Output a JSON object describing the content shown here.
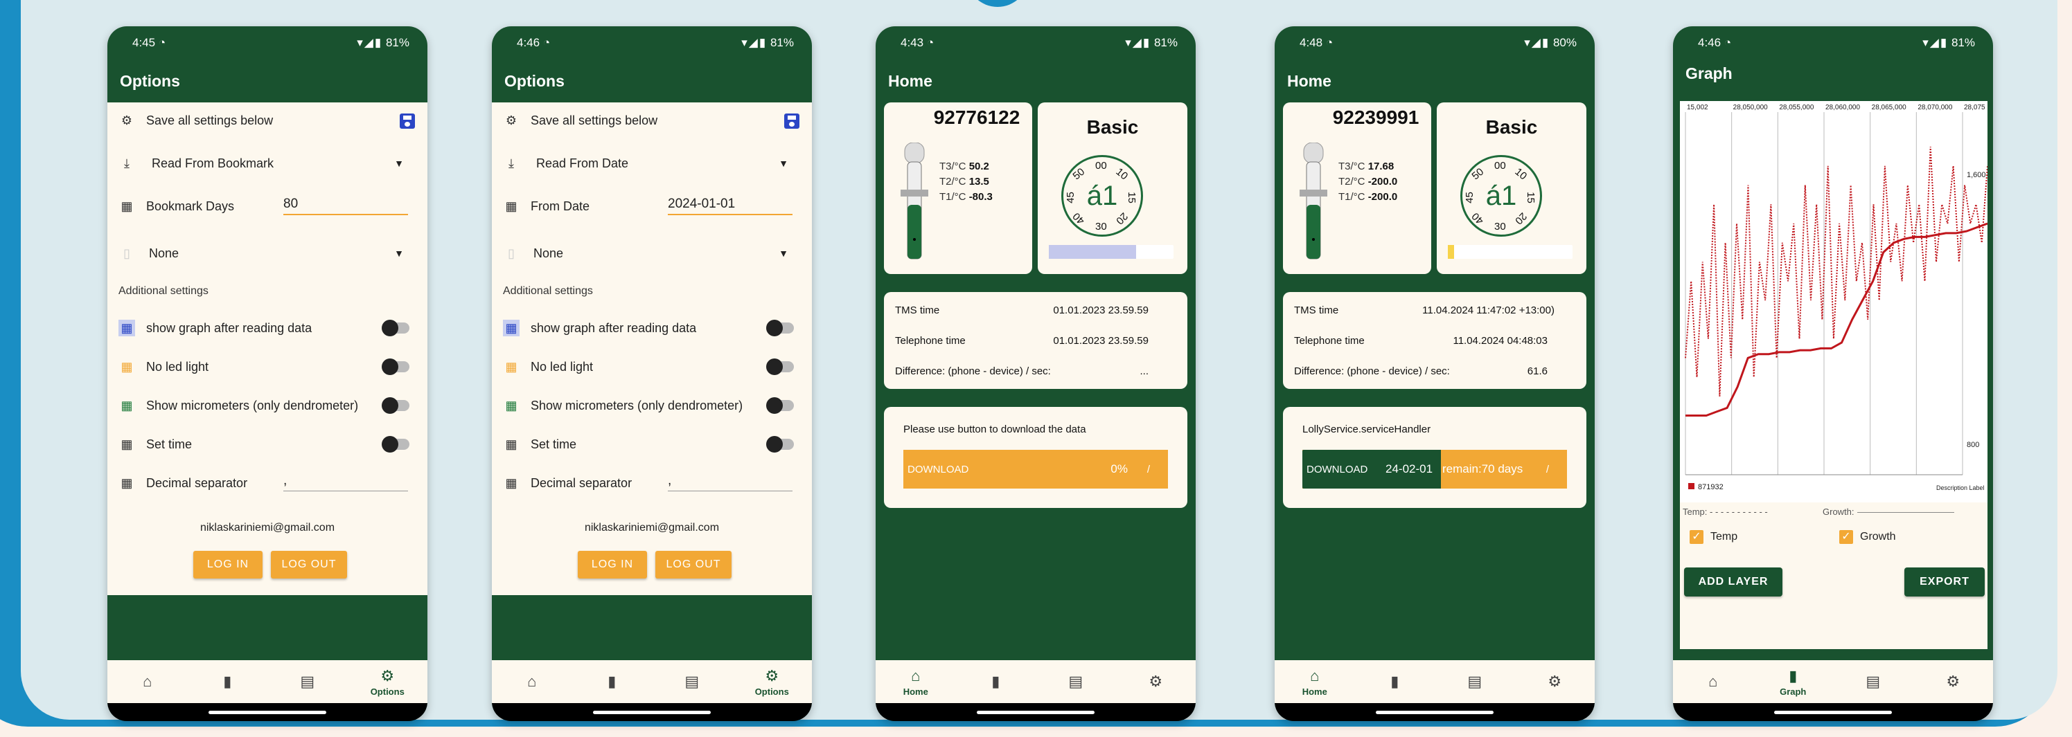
{
  "colors": {
    "primary": "#19522f",
    "accent": "#f2a835",
    "surface": "#fdf8ee",
    "series": "#c0161c"
  },
  "nav": {
    "home": "Home",
    "graph": "Graph",
    "options": "Options"
  },
  "status": {
    "icons": "▾◢▮"
  },
  "options1": {
    "time": "4:45",
    "battery": "81%",
    "title": "Options",
    "save_label": "Save all settings below",
    "read_mode": "Read From Bookmark",
    "field_label": "Bookmark Days",
    "field_value": "80",
    "none_label": "None",
    "additional": "Additional settings",
    "toggles": [
      "show graph after reading data",
      "No led light",
      "Show micrometers (only dendrometer)",
      "Set time"
    ],
    "decimal_label": "Decimal separator",
    "decimal_value": ",",
    "email": "niklaskariniemi@gmail.com",
    "login": "LOG IN",
    "logout": "LOG OUT"
  },
  "options2": {
    "time": "4:46",
    "battery": "81%",
    "title": "Options",
    "save_label": "Save all settings below",
    "read_mode": "Read From Date",
    "field_label": "From Date",
    "field_value": "2024-01-01",
    "none_label": "None",
    "additional": "Additional settings",
    "toggles": [
      "show graph after reading data",
      "No led light",
      "Show micrometers (only dendrometer)",
      "Set time"
    ],
    "decimal_label": "Decimal separator",
    "decimal_value": ",",
    "email": "niklaskariniemi@gmail.com",
    "login": "LOG IN",
    "logout": "LOG OUT"
  },
  "home1": {
    "time": "4:43",
    "battery": "81%",
    "title": "Home",
    "device_id": "92776122",
    "t3_label": "T3/°C",
    "t3": "50.2",
    "t2_label": "T2/°C",
    "t2": "13.5",
    "t1_label": "T1/°C",
    "t1": "-80.3",
    "model": "Basic",
    "dial_center": "á1",
    "dial_nums": [
      "00",
      "10",
      "15",
      "20",
      "30",
      "40",
      "45",
      "50"
    ],
    "progress_fraction": 0.7,
    "tms_label": "TMS time",
    "tms": "01.01.2023 23.59.59",
    "phone_label": "Telephone time",
    "phone": "01.01.2023 23.59.59",
    "diff_label": "Difference: (phone - device) / sec:",
    "diff": "...",
    "msg": "Please use button to download the data",
    "download": "DOWNLOAD",
    "pct": "0%",
    "slash": "/"
  },
  "home2": {
    "time": "4:48",
    "battery": "80%",
    "title": "Home",
    "device_id": "92239991",
    "t3_label": "T3/°C",
    "t3": "17.68",
    "t2_label": "T2/°C",
    "t2": "-200.0",
    "t1_label": "T1/°C",
    "t1": "-200.0",
    "model": "Basic",
    "dial_center": "á1",
    "dial_nums": [
      "00",
      "10",
      "15",
      "20",
      "30",
      "40",
      "45",
      "50"
    ],
    "progress_fraction": 0.05,
    "tms_label": "TMS time",
    "tms": "11.04.2024 11:47:02 +13:00)",
    "phone_label": "Telephone time",
    "phone": "11.04.2024 04:48:03",
    "diff_label": "Difference: (phone - device) / sec:",
    "diff": "61.6",
    "msg": "LollyService.serviceHandler",
    "download": "DOWNLOAD",
    "date": "24-02-01",
    "remain": "remain:70 days",
    "slash": "/"
  },
  "graph": {
    "time": "4:46",
    "battery": "81%",
    "title": "Graph",
    "legend_series": "871932",
    "desc_label": "Description Label",
    "temp_line": "Temp: - - - - - - - - - - -",
    "growth_line": "Growth:",
    "chk_temp": "Temp",
    "chk_growth": "Growth",
    "add_layer": "ADD LAYER",
    "export": "EXPORT"
  },
  "chart_data": {
    "type": "line",
    "x_ticks": [
      "15,002",
      "28,050,000",
      "28,055,000",
      "28,060,000",
      "28,065,000",
      "28,070,000",
      "28,075"
    ],
    "y_right_ticks": [
      "1,600",
      "800"
    ],
    "series": [
      {
        "name": "871932",
        "style": "dotted",
        "values": [
          5,
          9,
          4,
          10,
          6,
          13,
          3,
          11,
          5,
          12,
          7,
          14,
          4,
          10,
          8,
          13,
          5,
          11,
          9,
          12,
          6,
          14,
          8,
          13,
          7,
          15,
          6,
          12,
          8,
          14,
          9,
          11,
          7,
          13,
          8,
          15,
          10,
          12,
          9,
          14,
          11,
          13,
          9,
          16,
          10,
          13,
          12,
          15,
          10,
          14,
          12,
          13,
          11,
          15
        ]
      },
      {
        "style": "solid",
        "values": [
          2,
          2,
          2,
          2.2,
          2.4,
          3.5,
          5,
          5.2,
          5.2,
          5.3,
          5.3,
          5.4,
          5.4,
          5.5,
          5.5,
          5.8,
          7,
          8,
          9,
          10.5,
          11,
          11.2,
          11.3,
          11.3,
          11.4,
          11.5,
          11.5,
          11.6,
          11.8,
          12
        ]
      }
    ]
  }
}
